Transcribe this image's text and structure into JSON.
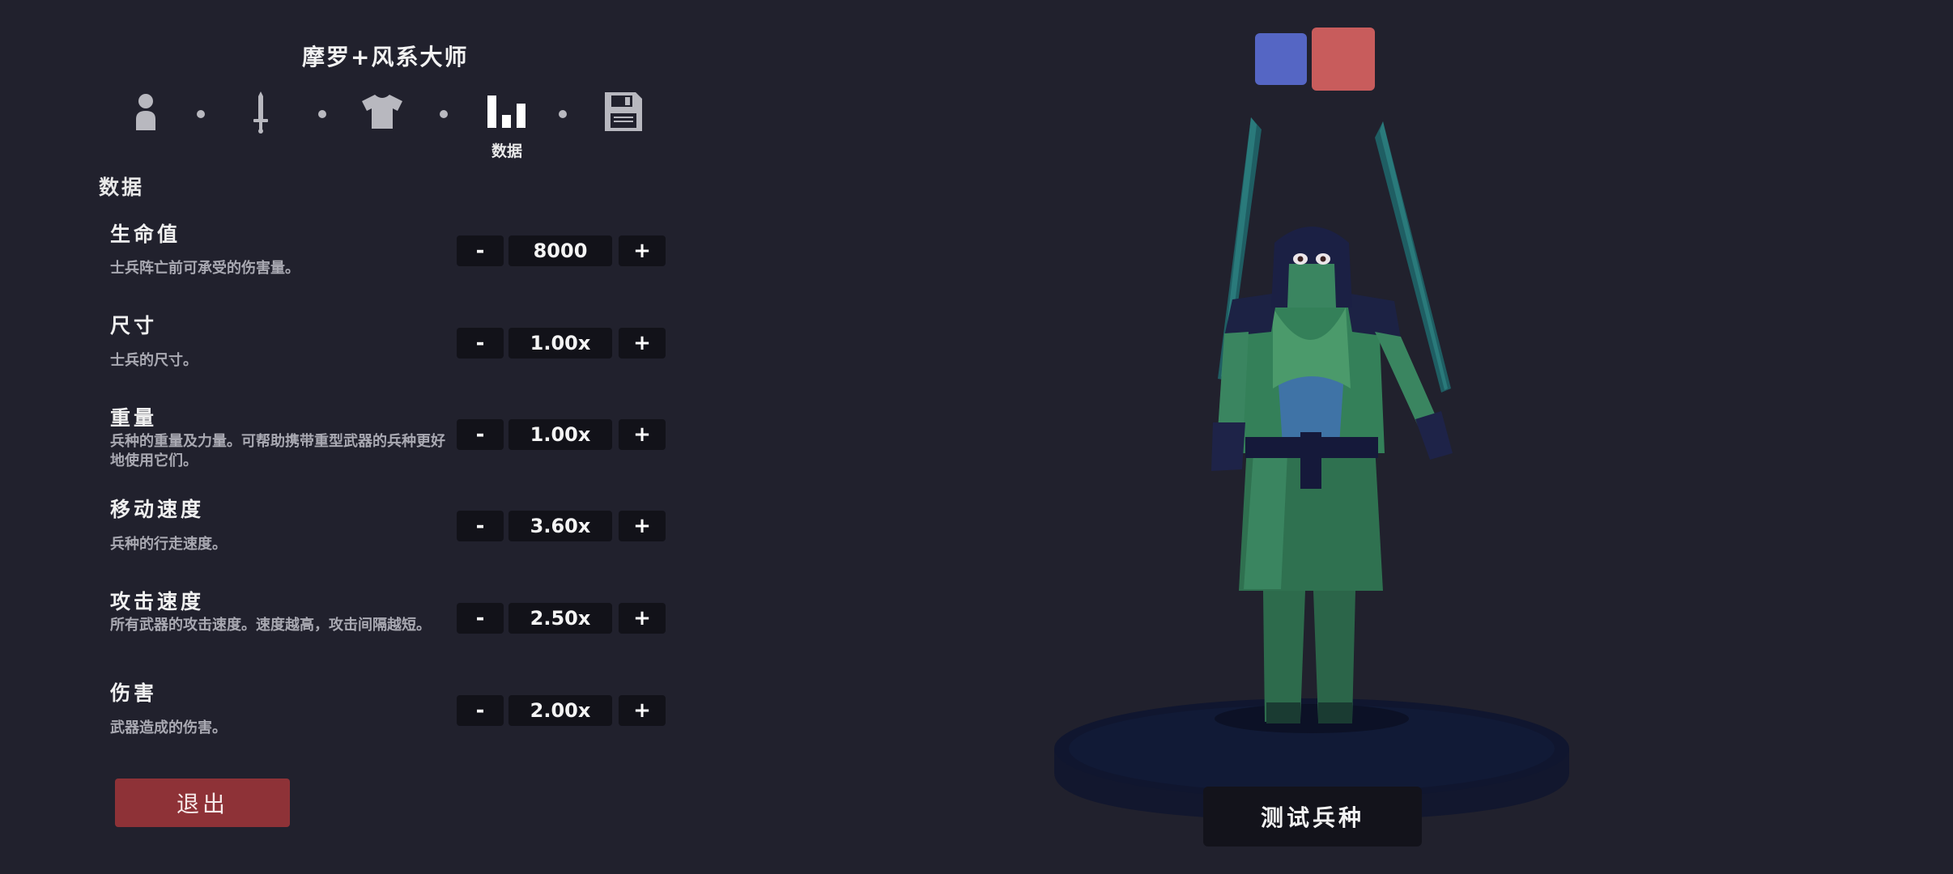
{
  "header": {
    "unit_name": "摩罗+风系大师"
  },
  "steps": {
    "items": [
      {
        "icon": "person-icon"
      },
      {
        "icon": "sword-icon"
      },
      {
        "icon": "shirt-icon"
      },
      {
        "icon": "bar-chart-icon",
        "active": true
      },
      {
        "icon": "save-icon"
      }
    ],
    "active_caption": "数据"
  },
  "section": {
    "title": "数据"
  },
  "stats": [
    {
      "name": "生命值",
      "description": "士兵阵亡前可承受的伤害量。",
      "value": "8000"
    },
    {
      "name": "尺寸",
      "description": "士兵的尺寸。",
      "value": "1.00x"
    },
    {
      "name": "重量",
      "description": "兵种的重量及力量。可帮助携带重型武器的兵种更好地使用它们。",
      "value": "1.00x"
    },
    {
      "name": "移动速度",
      "description": "兵种的行走速度。",
      "value": "3.60x"
    },
    {
      "name": "攻击速度",
      "description": "所有武器的攻击速度。速度越高，攻击间隔越短。",
      "value": "2.50x"
    },
    {
      "name": "伤害",
      "description": "武器造成的伤害。",
      "value": "2.00x"
    }
  ],
  "stepper": {
    "minus": "-",
    "plus": "+"
  },
  "buttons": {
    "exit": "退出",
    "test_unit": "测试兵种"
  },
  "colors": {
    "background": "#21212d",
    "team_blue": "#5566c4",
    "team_red": "#c85c5c",
    "exit_button": "#8e3237",
    "unit_green": "#3d8a5f"
  }
}
